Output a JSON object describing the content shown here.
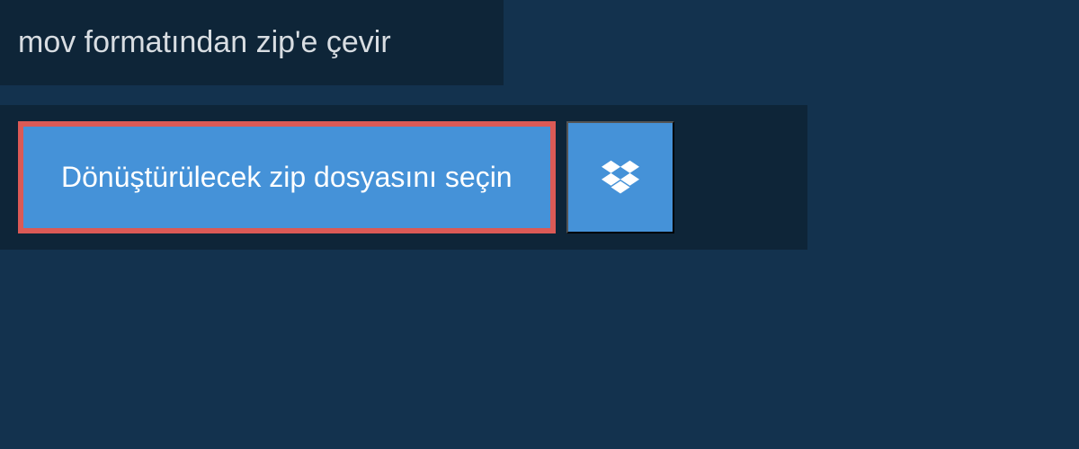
{
  "title": "mov formatından zip'e çevir",
  "buttons": {
    "select_file_label": "Dönüştürülecek zip dosyasını seçin"
  },
  "colors": {
    "background": "#13324e",
    "panel": "#0e2538",
    "button_primary": "#4592d8",
    "button_highlight_border": "#db5a56",
    "text_light": "#d8dde2"
  }
}
